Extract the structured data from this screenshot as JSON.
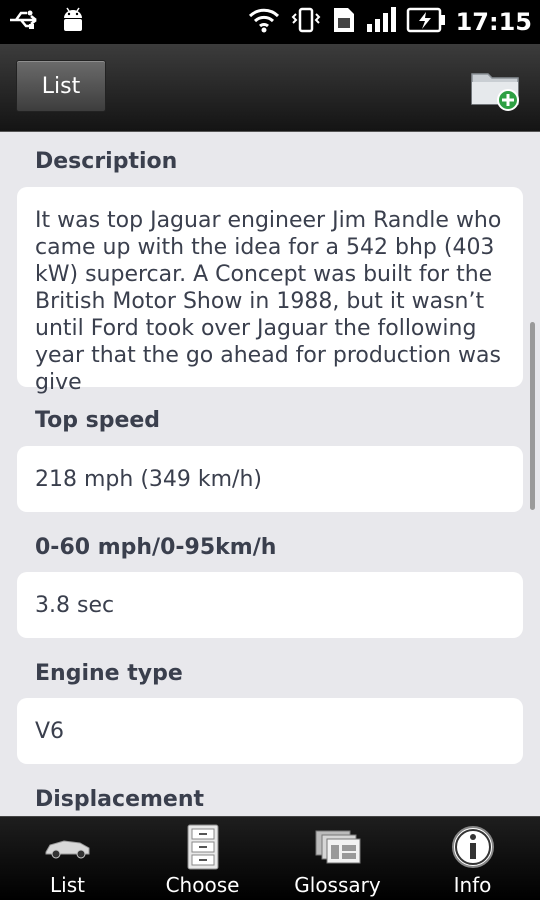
{
  "status_bar": {
    "time": "17:15",
    "icons": [
      "usb-icon",
      "android-debug-icon",
      "wifi-icon",
      "vibrate-icon",
      "sim-icon",
      "signal-icon",
      "battery-charging-icon"
    ]
  },
  "action_bar": {
    "list_button_label": "List",
    "folder_add_icon": "folder-add-icon"
  },
  "fields": [
    {
      "label": "Description",
      "value": "It was top Jaguar engineer Jim Randle who came up with the idea for a 542 bhp (403 kW) supercar. A Concept was built for the British Motor Show in 1988, but it wasn’t until Ford took over Jaguar the following year that the go ahead for production was give"
    },
    {
      "label": "Top speed",
      "value": "218 mph (349 km/h)"
    },
    {
      "label": "0-60 mph/0-95km/h",
      "value": "3.8 sec"
    },
    {
      "label": "Engine type",
      "value": "V6"
    },
    {
      "label": "Displacement",
      "value": ""
    }
  ],
  "tabs": [
    {
      "label": "List",
      "icon": "car-icon"
    },
    {
      "label": "Choose",
      "icon": "cabinet-icon"
    },
    {
      "label": "Glossary",
      "icon": "cards-icon"
    },
    {
      "label": "Info",
      "icon": "info-icon"
    }
  ],
  "colors": {
    "background": "#e8e8ec",
    "card": "#ffffff",
    "text": "#3a3f4d",
    "accent_green": "#2ea043"
  }
}
